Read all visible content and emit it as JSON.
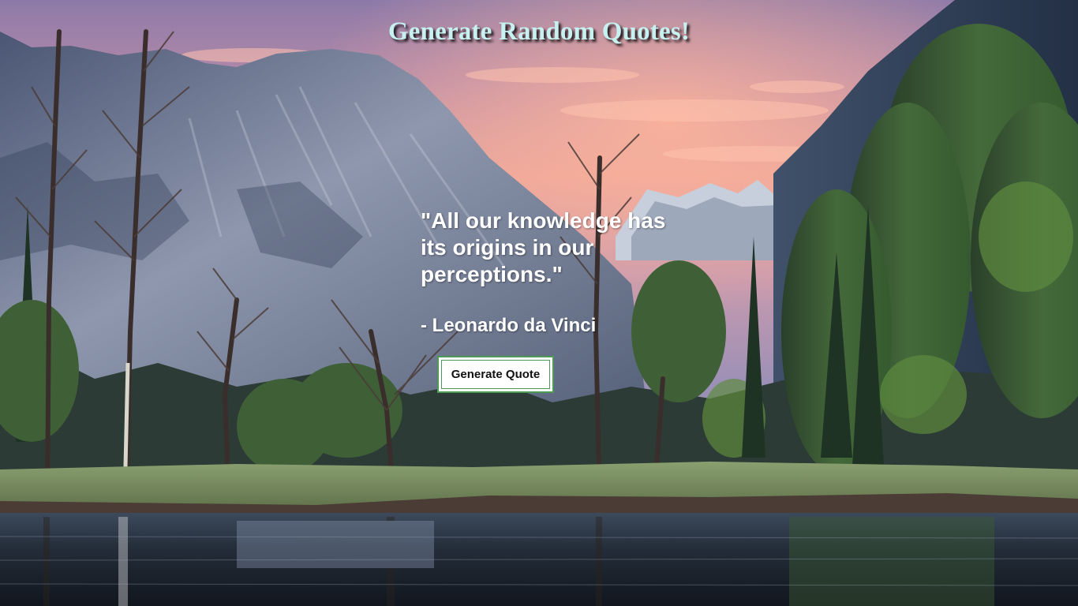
{
  "page": {
    "title": "Generate Random Quotes!"
  },
  "quote": {
    "text": "\"All our knowledge has its origins in our perceptions.\"",
    "author": "- Leonardo da Vinci"
  },
  "controls": {
    "generate_label": "Generate Quote"
  },
  "background": {
    "description_icon": "landscape-background",
    "colors": {
      "sky_top": "#7e6f9c",
      "sky_glow": "#f0a08e",
      "mountain": "#5d6a86",
      "forest": "#2e4a2c",
      "meadow": "#7f9468",
      "water": "#1d2530"
    }
  },
  "theme": {
    "title_color": "#c6f1f0",
    "button_border": "#4d9a56"
  }
}
